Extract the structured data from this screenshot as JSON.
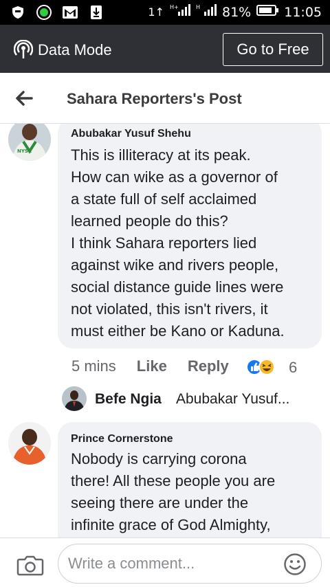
{
  "status_bar": {
    "network": "1↑",
    "signal1": "H+",
    "signal2": "H",
    "battery_percent": "81%",
    "time": "11:05",
    "icons": [
      "shield-icon",
      "whatsapp-icon",
      "gmail-icon",
      "download-icon",
      "signal-icon",
      "battery-icon"
    ]
  },
  "data_mode_bar": {
    "label": "Data Mode",
    "button_label": "Go to Free",
    "background": "#2f3035"
  },
  "header": {
    "title": "Sahara Reporters's Post",
    "back_icon": "back-arrow-icon"
  },
  "comments": [
    {
      "author": "Abubakar Yusuf Shehu",
      "avatar_badge": "NYSC",
      "lines": [
        "This is illiteracy at its peak.",
        "How can wike as a governor of",
        "a state full of self acclaimed",
        "learned people do this?",
        "I think Sahara reporters lied",
        "against wike and rivers people,",
        "social distance guide lines were",
        "not violated, this isn't rivers, it",
        "must either be Kano or Kaduna."
      ],
      "time": "5 mins",
      "like_label": "Like",
      "reply_label": "Reply",
      "reactions": [
        "like",
        "haha"
      ],
      "reaction_count": "6",
      "reply_preview": {
        "name": "Befe Ngia",
        "snippet": "Abubakar Yusuf..."
      }
    },
    {
      "author": "Prince Cornerstone",
      "lines": [
        "Nobody is carrying corona",
        "there! All these people you are",
        "seeing there are under the",
        "infinite grace of God Almighty,"
      ]
    }
  ],
  "composer": {
    "placeholder": "Write a comment...",
    "camera_icon": "camera-icon",
    "emoji_icon": "emoji-icon"
  },
  "colors": {
    "like_blue": "#1877f2",
    "haha_yellow": "#f7b928",
    "bubble_gray": "#f0f2f5",
    "meta_gray": "#65676b"
  }
}
